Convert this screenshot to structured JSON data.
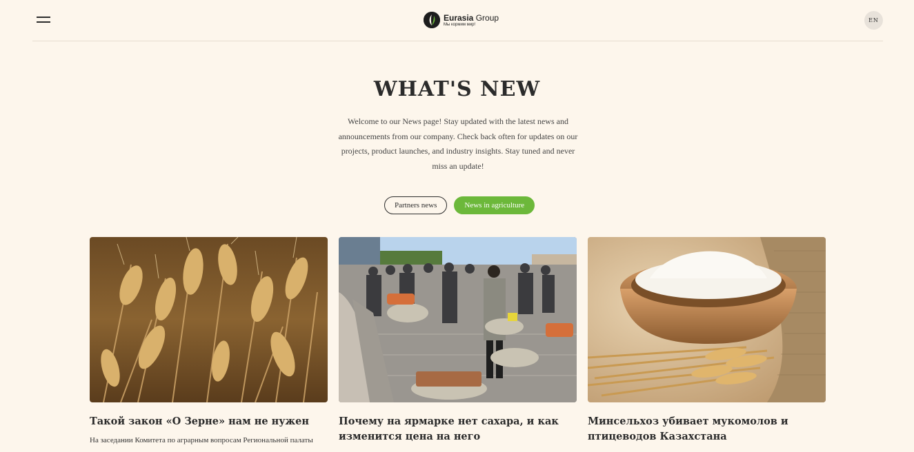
{
  "header": {
    "menu_icon": "hamburger-menu-icon",
    "logo": {
      "name_bold": "Eurasia",
      "name_regular": " Group",
      "tagline": "Мы кормим мир!"
    },
    "language": "EN"
  },
  "hero": {
    "title": "WHAT'S NEW",
    "intro": "Welcome to our News page! Stay updated with the latest news and announcements from our company. Check back often for updates on our projects, product launches, and industry insights. Stay tuned and never miss an update!"
  },
  "filters": [
    {
      "label": "Partners news",
      "active": false
    },
    {
      "label": "News in agriculture",
      "active": true
    }
  ],
  "colors": {
    "background": "#fdf6ec",
    "accent": "#6cb83a",
    "text": "#2b2b2b"
  },
  "articles": [
    {
      "image": "wheat-ears-photo",
      "title": "Такой закон «О Зерне» нам не нужен",
      "excerpt": "На заседании Комитета по аграрным вопросам Региональной палаты"
    },
    {
      "image": "market-fair-photo",
      "title": "Почему на ярмарке нет сахара, и как изменится цена на него",
      "excerpt": ""
    },
    {
      "image": "flour-bowl-photo",
      "title": "Минсельхоз убивает мукомолов и птицеводов Казахстана",
      "excerpt": ""
    }
  ]
}
